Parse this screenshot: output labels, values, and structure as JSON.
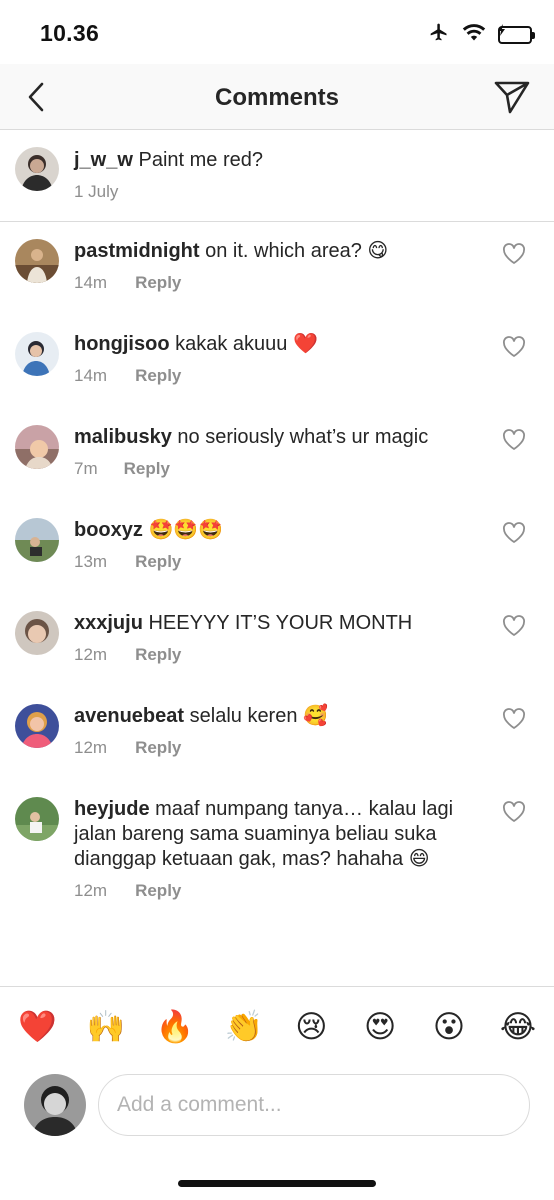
{
  "status": {
    "time": "10.36"
  },
  "nav": {
    "title": "Comments"
  },
  "caption": {
    "username": "j_w_w",
    "text": "Paint me red?",
    "date": "1 July"
  },
  "comments": [
    {
      "username": "pastmidnight",
      "text": "on it. which area? 😋",
      "time": "14m",
      "reply": "Reply"
    },
    {
      "username": "hongjisoo",
      "text": "kakak akuuu ❤️",
      "time": "14m",
      "reply": "Reply"
    },
    {
      "username": "malibusky",
      "text": "no seriously what’s ur magic",
      "time": "7m",
      "reply": "Reply"
    },
    {
      "username": "booxyz",
      "text": "🤩🤩🤩",
      "time": "13m",
      "reply": "Reply"
    },
    {
      "username": "xxxjuju",
      "text": "HEEYYY IT’S YOUR MONTH",
      "time": "12m",
      "reply": "Reply"
    },
    {
      "username": "avenuebeat",
      "text": "selalu keren 🥰",
      "time": "12m",
      "reply": "Reply"
    },
    {
      "username": "heyjude",
      "line1": "maaf numpang tanya… kalau lagi",
      "line2": "jalan bareng sama suaminya beliau suka",
      "line3": "dianggap ketuaan gak, mas? hahaha 😄",
      "time": "12m",
      "reply": "Reply"
    }
  ],
  "emoji_bar": [
    "❤️",
    "🙌",
    "🔥",
    "👏",
    "😢",
    "😍",
    "😮",
    "😂"
  ],
  "composer": {
    "placeholder": "Add a comment..."
  },
  "colors": {
    "text": "#262626",
    "secondary": "#8e8e8e",
    "divider": "#dbdbdb",
    "battery": "#4cd964"
  },
  "icons": [
    "airplane-icon",
    "wifi-icon",
    "battery-icon",
    "back-chevron-icon",
    "send-icon",
    "heart-outline-icon"
  ]
}
